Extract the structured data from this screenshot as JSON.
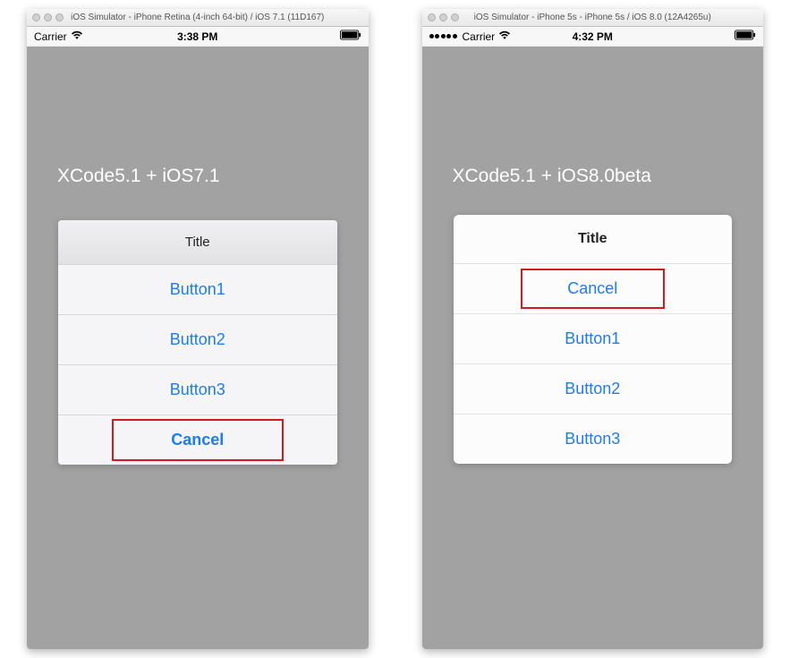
{
  "left": {
    "titlebar": "iOS Simulator - iPhone Retina (4-inch 64-bit) / iOS 7.1 (11D167)",
    "carrier": "Carrier",
    "time": "3:38 PM",
    "overlay_label": "XCode5.1 + iOS7.1",
    "sheet_title": "Title",
    "buttons": {
      "b1": "Button1",
      "b2": "Button2",
      "b3": "Button3",
      "cancel": "Cancel"
    }
  },
  "right": {
    "titlebar": "iOS Simulator - iPhone 5s - iPhone 5s / iOS 8.0 (12A4265u)",
    "carrier": "Carrier",
    "time": "4:32 PM",
    "overlay_label": "XCode5.1 + iOS8.0beta",
    "sheet_title": "Title",
    "buttons": {
      "cancel": "Cancel",
      "b1": "Button1",
      "b2": "Button2",
      "b3": "Button3"
    }
  }
}
